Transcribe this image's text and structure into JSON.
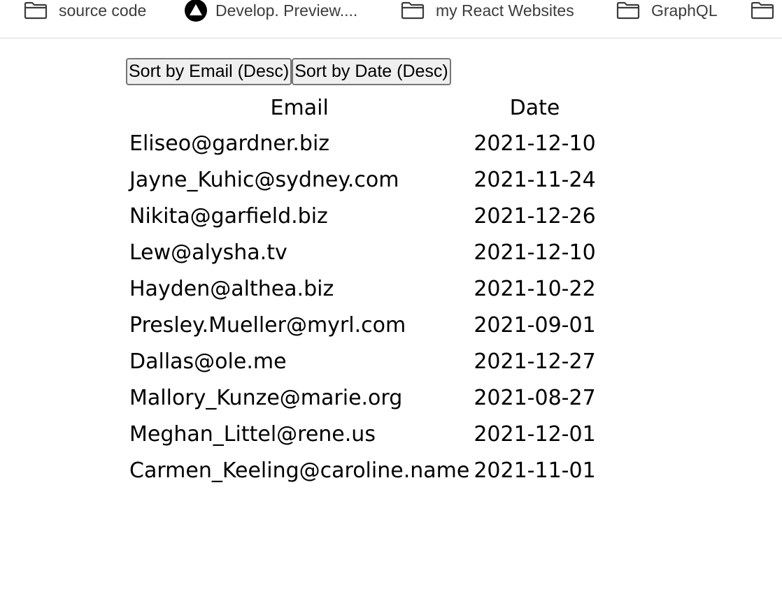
{
  "bookmarks": [
    {
      "label": "source code",
      "icon": "folder-icon"
    },
    {
      "label": "Develop. Preview....",
      "icon": "vercel-triangle-icon"
    },
    {
      "label": "my React Websites",
      "icon": "folder-icon"
    },
    {
      "label": "GraphQL",
      "icon": "folder-icon"
    },
    {
      "label": "",
      "icon": "folder-icon"
    }
  ],
  "controls": {
    "sort_email_label": "Sort by Email (Desc)",
    "sort_date_label": "Sort by Date (Desc)"
  },
  "table": {
    "headers": {
      "email": "Email",
      "date": "Date"
    },
    "rows": [
      {
        "email": "Eliseo@gardner.biz",
        "date": "2021-12-10"
      },
      {
        "email": "Jayne_Kuhic@sydney.com",
        "date": "2021-11-24"
      },
      {
        "email": "Nikita@garfield.biz",
        "date": "2021-12-26"
      },
      {
        "email": "Lew@alysha.tv",
        "date": "2021-12-10"
      },
      {
        "email": "Hayden@althea.biz",
        "date": "2021-10-22"
      },
      {
        "email": "Presley.Mueller@myrl.com",
        "date": "2021-09-01"
      },
      {
        "email": "Dallas@ole.me",
        "date": "2021-12-27"
      },
      {
        "email": "Mallory_Kunze@marie.org",
        "date": "2021-08-27"
      },
      {
        "email": "Meghan_Littel@rene.us",
        "date": "2021-12-01"
      },
      {
        "email": "Carmen_Keeling@caroline.name",
        "date": "2021-11-01"
      }
    ]
  }
}
